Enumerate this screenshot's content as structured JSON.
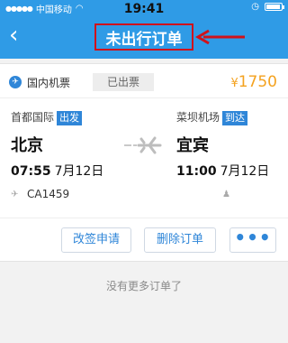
{
  "status_bar": {
    "carrier": "中国移动",
    "time": "19:41"
  },
  "nav": {
    "back_icon": "‹",
    "title": "未出行订单"
  },
  "order": {
    "type_label": "国内机票",
    "status": "已出票",
    "price_currency": "¥",
    "price_value": "1750",
    "departure": {
      "airport": "首都国际",
      "tag": "出发",
      "city": "北京",
      "time": "07:55",
      "date": "7月12日"
    },
    "arrival": {
      "airport": "菜坝机场",
      "tag": "到达",
      "city": "宜宾",
      "time": "11:00",
      "date": "7月12日"
    },
    "flight_no": "CA1459"
  },
  "actions": {
    "change": "改签申请",
    "delete": "删除订单",
    "more": "•••"
  },
  "footer_text": "没有更多订单了",
  "colors": {
    "primary": "#2f9be6",
    "accent_price": "#f4a21f",
    "highlight_box": "#d0121b"
  }
}
